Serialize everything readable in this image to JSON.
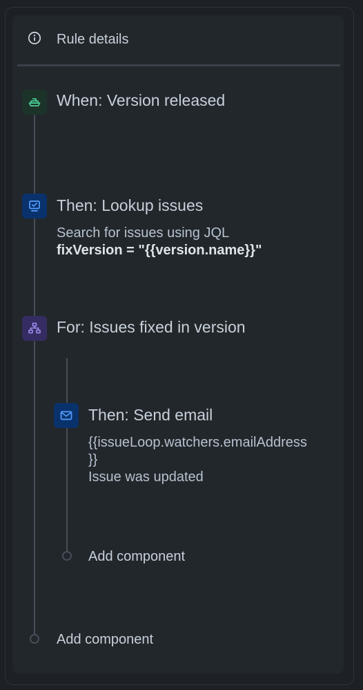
{
  "header": {
    "title": "Rule details",
    "icon": "info-icon"
  },
  "steps": [
    {
      "title": "When: Version released",
      "icon": "ship-icon",
      "icon_bg": "#1c3329",
      "icon_color": "#4bce97"
    },
    {
      "title": "Then: Lookup issues",
      "icon": "monitor-check-icon",
      "icon_bg": "#09326c",
      "icon_color": "#579dff",
      "description": "Search for issues using JQL",
      "query": "fixVersion = \"{{version.name}}\""
    },
    {
      "title": "For: Issues fixed in version",
      "icon": "hierarchy-icon",
      "icon_bg": "#352c63",
      "icon_color": "#9f8fef",
      "children": [
        {
          "title": "Then: Send email",
          "icon": "email-icon",
          "icon_bg": "#09326c",
          "icon_color": "#579dff",
          "recipient_line1": "{{issueLoop.watchers.emailAddress",
          "recipient_line2": "}}",
          "subject": "Issue was updated"
        }
      ],
      "add_component": "Add component"
    }
  ],
  "add_component": "Add component",
  "colors": {
    "background": "#1d2024",
    "panel": "#22272b",
    "connector": "#454f59"
  }
}
